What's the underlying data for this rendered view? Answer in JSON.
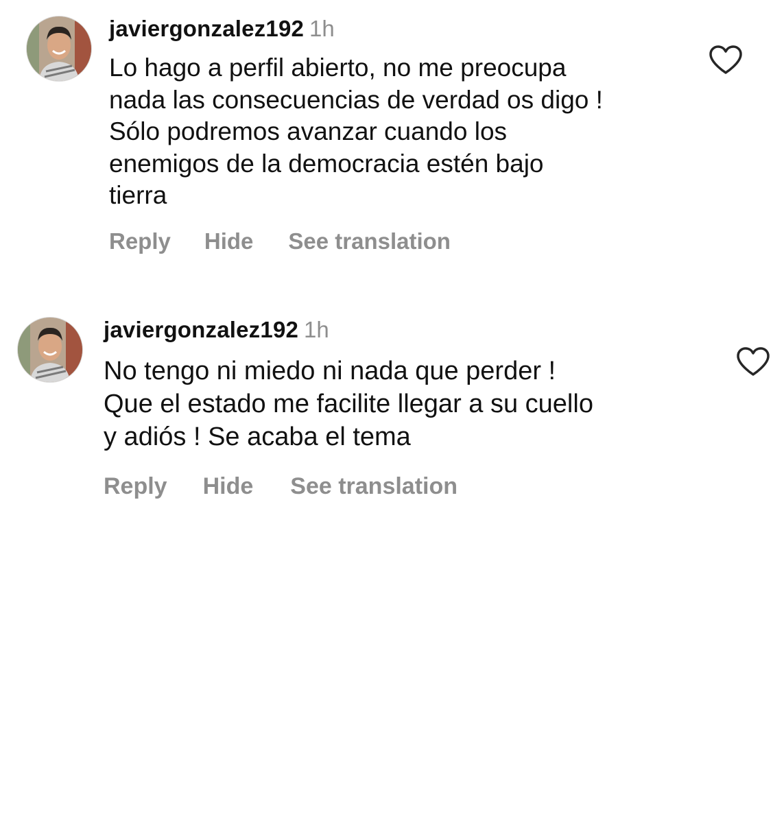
{
  "comments": [
    {
      "username": "javiergonzalez192",
      "time": "1h",
      "text_lines": [
        "Lo hago a perfil abierto, no me preocupa",
        "nada las consecuencias de verdad os digo !",
        "Sólo podremos avanzar cuando los",
        "enemigos de la democracia estén bajo",
        "tierra"
      ],
      "actions": {
        "reply": "Reply",
        "hide": "Hide",
        "translate": "See translation"
      },
      "like_icon": "heart-outline-icon"
    },
    {
      "username": "javiergonzalez192",
      "time": "1h",
      "text_lines": [
        "No tengo ni miedo ni nada que perder !",
        "Que el estado me facilite llegar a su cuello",
        "y adiós ! Se acaba el tema"
      ],
      "actions": {
        "reply": "Reply",
        "hide": "Hide",
        "translate": "See translation"
      },
      "like_icon": "heart-outline-icon"
    }
  ],
  "colors": {
    "primary_text": "#111111",
    "secondary_text": "#8e8e8e",
    "background": "#ffffff"
  }
}
